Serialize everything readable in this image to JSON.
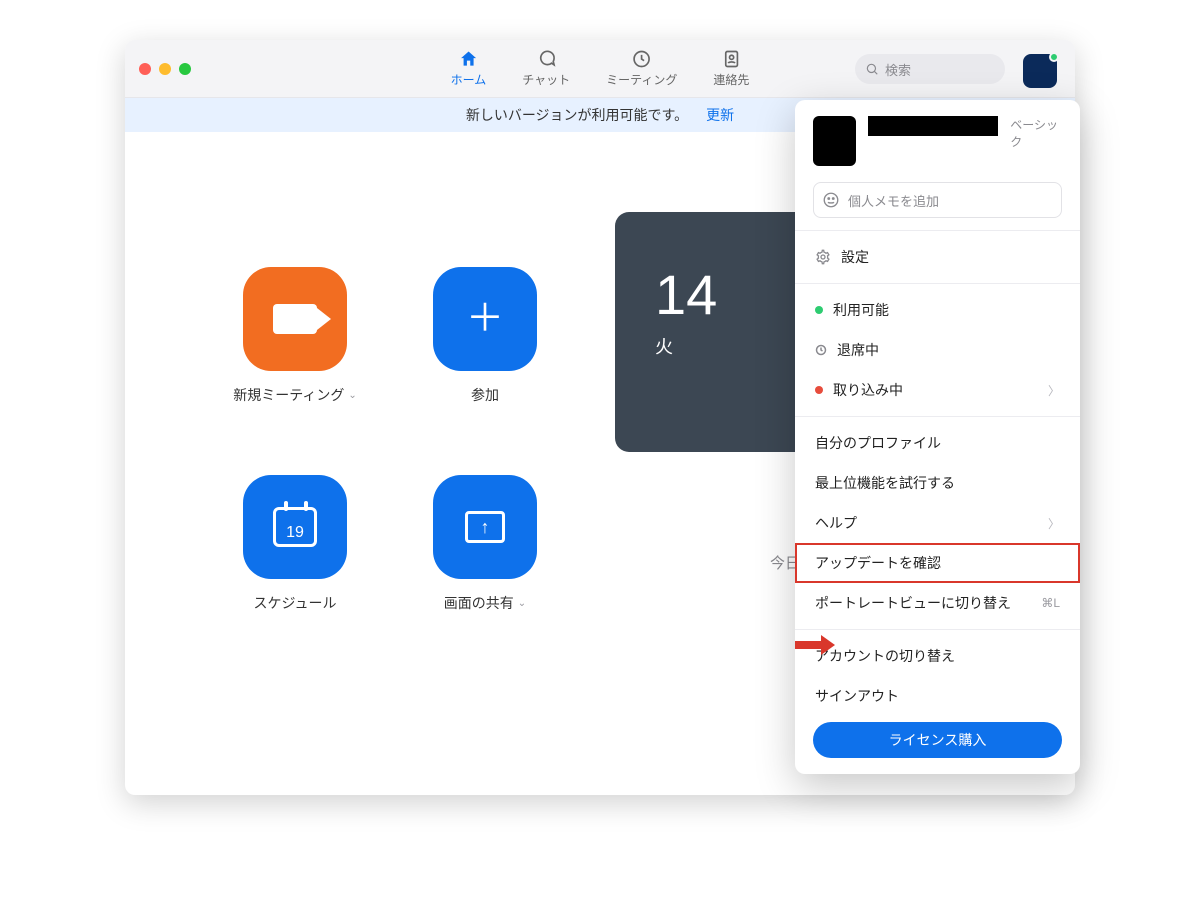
{
  "header": {
    "tabs": [
      {
        "label": "ホーム"
      },
      {
        "label": "チャット"
      },
      {
        "label": "ミーティング"
      },
      {
        "label": "連絡先"
      }
    ],
    "search_placeholder": "検索"
  },
  "banner": {
    "text": "新しいバージョンが利用可能です。",
    "link": "更新"
  },
  "tiles": {
    "new_meeting": "新規ミーティング",
    "join": "参加",
    "schedule": "スケジュール",
    "share_screen": "画面の共有",
    "calendar_day": "19"
  },
  "clock": {
    "time": "14",
    "day": "火"
  },
  "today_text": "今日これから発生す",
  "menu": {
    "plan": "ベーシック",
    "memo_placeholder": "個人メモを追加",
    "settings": "設定",
    "status": {
      "available": "利用可能",
      "away": "退席中",
      "dnd": "取り込み中"
    },
    "profile": "自分のプロファイル",
    "try_top": "最上位機能を試行する",
    "help": "ヘルプ",
    "check_update": "アップデートを確認",
    "portrait": "ポートレートビューに切り替え",
    "portrait_kbd": "⌘L",
    "switch_account": "アカウントの切り替え",
    "sign_out": "サインアウト",
    "license": "ライセンス購入"
  }
}
